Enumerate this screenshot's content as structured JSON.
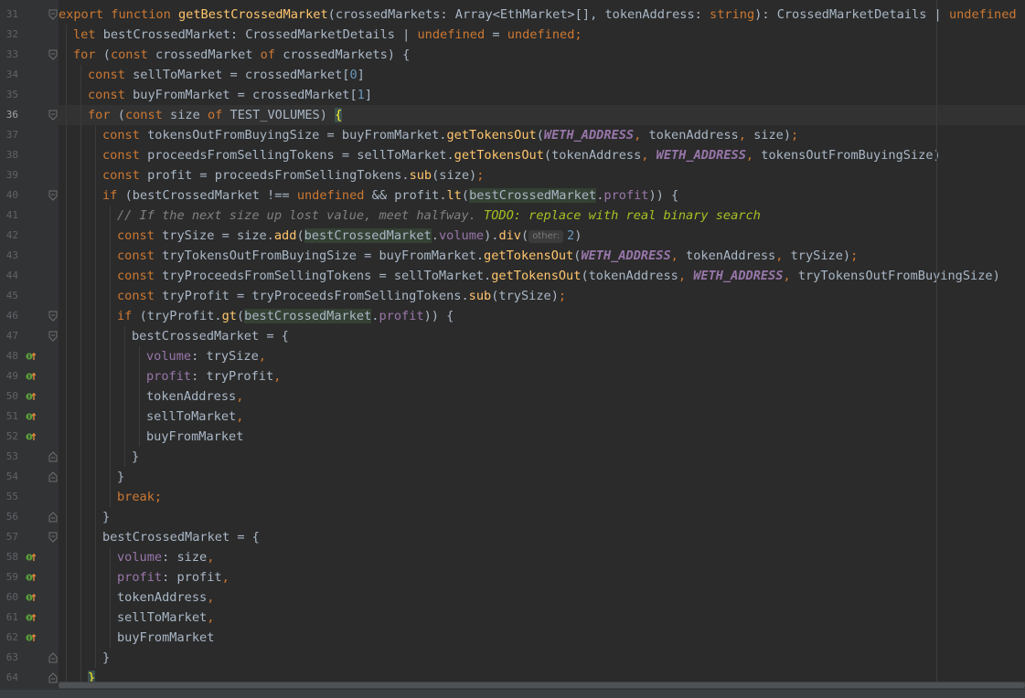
{
  "editor": {
    "current_line": 36,
    "lines": [
      {
        "n": "31",
        "indent": 0,
        "fold": "open",
        "impl": false,
        "tokens": [
          [
            "kw",
            "export function "
          ],
          [
            "fn",
            "getBestCrossedMarket"
          ],
          [
            "p",
            "(crossedMarkets: Array<EthMarket>[], tokenAddress: "
          ],
          [
            "kw",
            "string"
          ],
          [
            "p",
            "): CrossedMarketDetails | "
          ],
          [
            "kw",
            "undefined"
          ],
          [
            "p",
            " {"
          ]
        ]
      },
      {
        "n": "32",
        "indent": 1,
        "fold": "",
        "impl": false,
        "tokens": [
          [
            "kw",
            "let "
          ],
          [
            "p",
            "bestCrossedMarket: CrossedMarketDetails | "
          ],
          [
            "kw",
            "undefined"
          ],
          [
            "p",
            " = "
          ],
          [
            "kw",
            "undefined;"
          ]
        ]
      },
      {
        "n": "33",
        "indent": 1,
        "fold": "open",
        "impl": false,
        "tokens": [
          [
            "kw",
            "for "
          ],
          [
            "p",
            "("
          ],
          [
            "kw",
            "const "
          ],
          [
            "p",
            "crossedMarket "
          ],
          [
            "kw",
            "of "
          ],
          [
            "p",
            "crossedMarkets) {"
          ]
        ]
      },
      {
        "n": "34",
        "indent": 2,
        "fold": "",
        "impl": false,
        "tokens": [
          [
            "kw",
            "const "
          ],
          [
            "p",
            "sellToMarket = crossedMarket["
          ],
          [
            "num",
            "0"
          ],
          [
            "p",
            "]"
          ]
        ]
      },
      {
        "n": "35",
        "indent": 2,
        "fold": "",
        "impl": false,
        "tokens": [
          [
            "kw",
            "const "
          ],
          [
            "p",
            "buyFromMarket = crossedMarket["
          ],
          [
            "num",
            "1"
          ],
          [
            "p",
            "]"
          ]
        ]
      },
      {
        "n": "36",
        "indent": 2,
        "fold": "open",
        "impl": false,
        "tokens": [
          [
            "kw",
            "for "
          ],
          [
            "p",
            "("
          ],
          [
            "kw",
            "const "
          ],
          [
            "p",
            "size "
          ],
          [
            "kw",
            "of "
          ],
          [
            "p",
            "TEST_VOLUMES) "
          ],
          [
            "brace",
            "{"
          ]
        ]
      },
      {
        "n": "37",
        "indent": 3,
        "fold": "",
        "impl": false,
        "tokens": [
          [
            "kw",
            "const "
          ],
          [
            "p",
            "tokensOutFromBuyingSize = buyFromMarket."
          ],
          [
            "fn",
            "getTokensOut"
          ],
          [
            "p",
            "("
          ],
          [
            "const",
            "WETH_ADDRESS"
          ],
          [
            "kw",
            ", "
          ],
          [
            "p",
            "tokenAddress"
          ],
          [
            "kw",
            ", "
          ],
          [
            "p",
            "size)"
          ],
          [
            "kw",
            ";"
          ]
        ]
      },
      {
        "n": "38",
        "indent": 3,
        "fold": "",
        "impl": false,
        "tokens": [
          [
            "kw",
            "const "
          ],
          [
            "p",
            "proceedsFromSellingTokens = sellToMarket."
          ],
          [
            "fn",
            "getTokensOut"
          ],
          [
            "p",
            "(tokenAddress"
          ],
          [
            "kw",
            ", "
          ],
          [
            "const",
            "WETH_ADDRESS"
          ],
          [
            "kw",
            ", "
          ],
          [
            "p",
            "tokensOutFromBuyingSize)"
          ]
        ]
      },
      {
        "n": "39",
        "indent": 3,
        "fold": "",
        "impl": false,
        "tokens": [
          [
            "kw",
            "const "
          ],
          [
            "p",
            "profit = proceedsFromSellingTokens."
          ],
          [
            "fn",
            "sub"
          ],
          [
            "p",
            "(size)"
          ],
          [
            "kw",
            ";"
          ]
        ]
      },
      {
        "n": "40",
        "indent": 3,
        "fold": "open",
        "impl": false,
        "tokens": [
          [
            "kw",
            "if "
          ],
          [
            "p",
            "(bestCrossedMarket !== "
          ],
          [
            "kw",
            "undefined "
          ],
          [
            "p",
            "&& profit."
          ],
          [
            "fn",
            "lt"
          ],
          [
            "p",
            "("
          ],
          [
            "hl",
            "bestCrossedMarket"
          ],
          [
            "p",
            "."
          ],
          [
            "prop",
            "profit"
          ],
          [
            "p",
            ")) {"
          ]
        ]
      },
      {
        "n": "41",
        "indent": 4,
        "fold": "",
        "impl": false,
        "tokens": [
          [
            "cmt",
            "// If the next size up lost value, meet halfway. "
          ],
          [
            "todo",
            "TODO: replace with real binary search"
          ]
        ]
      },
      {
        "n": "42",
        "indent": 4,
        "fold": "",
        "impl": false,
        "tokens": [
          [
            "kw",
            "const "
          ],
          [
            "p",
            "trySize = size."
          ],
          [
            "fn",
            "add"
          ],
          [
            "p",
            "("
          ],
          [
            "hl",
            "bestCrossedMarket"
          ],
          [
            "p",
            "."
          ],
          [
            "prop",
            "volume"
          ],
          [
            "p",
            ")."
          ],
          [
            "fn",
            "div"
          ],
          [
            "p",
            "("
          ],
          [
            "hint",
            "other:"
          ],
          [
            "num",
            "2"
          ],
          [
            "p",
            ")"
          ]
        ]
      },
      {
        "n": "43",
        "indent": 4,
        "fold": "",
        "impl": false,
        "tokens": [
          [
            "kw",
            "const "
          ],
          [
            "p",
            "tryTokensOutFromBuyingSize = buyFromMarket."
          ],
          [
            "fn",
            "getTokensOut"
          ],
          [
            "p",
            "("
          ],
          [
            "const",
            "WETH_ADDRESS"
          ],
          [
            "kw",
            ", "
          ],
          [
            "p",
            "tokenAddress"
          ],
          [
            "kw",
            ", "
          ],
          [
            "p",
            "trySize)"
          ],
          [
            "kw",
            ";"
          ]
        ]
      },
      {
        "n": "44",
        "indent": 4,
        "fold": "",
        "impl": false,
        "tokens": [
          [
            "kw",
            "const "
          ],
          [
            "p",
            "tryProceedsFromSellingTokens = sellToMarket."
          ],
          [
            "fn",
            "getTokensOut"
          ],
          [
            "p",
            "(tokenAddress"
          ],
          [
            "kw",
            ", "
          ],
          [
            "const",
            "WETH_ADDRESS"
          ],
          [
            "kw",
            ", "
          ],
          [
            "p",
            "tryTokensOutFromBuyingSize)"
          ]
        ]
      },
      {
        "n": "45",
        "indent": 4,
        "fold": "",
        "impl": false,
        "tokens": [
          [
            "kw",
            "const "
          ],
          [
            "p",
            "tryProfit = tryProceedsFromSellingTokens."
          ],
          [
            "fn",
            "sub"
          ],
          [
            "p",
            "(trySize)"
          ],
          [
            "kw",
            ";"
          ]
        ]
      },
      {
        "n": "46",
        "indent": 4,
        "fold": "open",
        "impl": false,
        "tokens": [
          [
            "kw",
            "if "
          ],
          [
            "p",
            "(tryProfit."
          ],
          [
            "fn",
            "gt"
          ],
          [
            "p",
            "("
          ],
          [
            "hl",
            "bestCrossedMarket"
          ],
          [
            "p",
            "."
          ],
          [
            "prop",
            "profit"
          ],
          [
            "p",
            ")) {"
          ]
        ]
      },
      {
        "n": "47",
        "indent": 5,
        "fold": "open",
        "impl": false,
        "tokens": [
          [
            "p",
            "bestCrossedMarket = {"
          ]
        ]
      },
      {
        "n": "48",
        "indent": 6,
        "fold": "",
        "impl": true,
        "tokens": [
          [
            "prop",
            "volume"
          ],
          [
            "p",
            ": trySize"
          ],
          [
            "kw",
            ","
          ]
        ]
      },
      {
        "n": "49",
        "indent": 6,
        "fold": "",
        "impl": true,
        "tokens": [
          [
            "prop",
            "profit"
          ],
          [
            "p",
            ": tryProfit"
          ],
          [
            "kw",
            ","
          ]
        ]
      },
      {
        "n": "50",
        "indent": 6,
        "fold": "",
        "impl": true,
        "tokens": [
          [
            "p",
            "tokenAddress"
          ],
          [
            "kw",
            ","
          ]
        ]
      },
      {
        "n": "51",
        "indent": 6,
        "fold": "",
        "impl": true,
        "tokens": [
          [
            "p",
            "sellToMarket"
          ],
          [
            "kw",
            ","
          ]
        ]
      },
      {
        "n": "52",
        "indent": 6,
        "fold": "",
        "impl": true,
        "tokens": [
          [
            "p",
            "buyFromMarket"
          ]
        ]
      },
      {
        "n": "53",
        "indent": 5,
        "fold": "close",
        "impl": false,
        "tokens": [
          [
            "p",
            "}"
          ]
        ]
      },
      {
        "n": "54",
        "indent": 4,
        "fold": "close",
        "impl": false,
        "tokens": [
          [
            "p",
            "}"
          ]
        ]
      },
      {
        "n": "55",
        "indent": 4,
        "fold": "",
        "impl": false,
        "tokens": [
          [
            "kw",
            "break;"
          ]
        ]
      },
      {
        "n": "56",
        "indent": 3,
        "fold": "close",
        "impl": false,
        "tokens": [
          [
            "p",
            "}"
          ]
        ]
      },
      {
        "n": "57",
        "indent": 3,
        "fold": "open",
        "impl": false,
        "tokens": [
          [
            "p",
            "bestCrossedMarket = {"
          ]
        ]
      },
      {
        "n": "58",
        "indent": 4,
        "fold": "",
        "impl": true,
        "tokens": [
          [
            "prop",
            "volume"
          ],
          [
            "p",
            ": size"
          ],
          [
            "kw",
            ","
          ]
        ]
      },
      {
        "n": "59",
        "indent": 4,
        "fold": "",
        "impl": true,
        "tokens": [
          [
            "prop",
            "profit"
          ],
          [
            "p",
            ": profit"
          ],
          [
            "kw",
            ","
          ]
        ]
      },
      {
        "n": "60",
        "indent": 4,
        "fold": "",
        "impl": true,
        "tokens": [
          [
            "p",
            "tokenAddress"
          ],
          [
            "kw",
            ","
          ]
        ]
      },
      {
        "n": "61",
        "indent": 4,
        "fold": "",
        "impl": true,
        "tokens": [
          [
            "p",
            "sellToMarket"
          ],
          [
            "kw",
            ","
          ]
        ]
      },
      {
        "n": "62",
        "indent": 4,
        "fold": "",
        "impl": true,
        "tokens": [
          [
            "p",
            "buyFromMarket"
          ]
        ]
      },
      {
        "n": "63",
        "indent": 3,
        "fold": "close",
        "impl": false,
        "tokens": [
          [
            "p",
            "}"
          ]
        ]
      },
      {
        "n": "64",
        "indent": 2,
        "fold": "close",
        "impl": false,
        "tokens": [
          [
            "brace",
            "}"
          ]
        ]
      }
    ]
  },
  "colors": {
    "background": "#2b2b2b",
    "gutter": "#313335",
    "keyword": "#cc7832",
    "function": "#ffc66d",
    "property": "#9876aa",
    "number": "#6897bb",
    "comment": "#808080",
    "todo": "#a8c023"
  },
  "icons": {
    "implements": "implements-interface-icon",
    "fold_open": "fold-open-icon",
    "fold_close": "fold-close-icon"
  }
}
